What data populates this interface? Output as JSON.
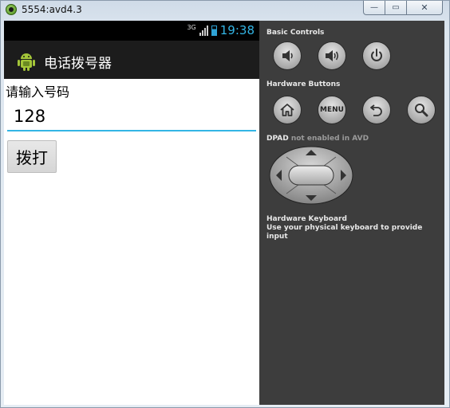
{
  "window": {
    "title": "5554:avd4.3",
    "controls": {
      "minimize": "—",
      "maximize": "▭",
      "close": "✕"
    }
  },
  "device": {
    "status_bar": {
      "network": "3G",
      "time": "19:38"
    },
    "action_bar": {
      "app_title": "电话拨号器",
      "icon": "android-icon"
    },
    "content": {
      "prompt_label": "请输入号码",
      "phone_input": {
        "value": "128",
        "placeholder": ""
      },
      "dial_button": "拨打"
    }
  },
  "controls_panel": {
    "basic_controls": {
      "title": "Basic Controls",
      "buttons": [
        {
          "name": "volume-down",
          "icon": "volume-down-icon"
        },
        {
          "name": "volume-up",
          "icon": "volume-up-icon"
        },
        {
          "name": "power",
          "icon": "power-icon"
        }
      ]
    },
    "hardware_buttons": {
      "title": "Hardware Buttons",
      "buttons": [
        {
          "name": "home",
          "icon": "home-icon"
        },
        {
          "name": "menu",
          "label": "MENU"
        },
        {
          "name": "back",
          "icon": "back-icon"
        },
        {
          "name": "search",
          "icon": "search-icon"
        }
      ]
    },
    "dpad": {
      "title": "DPAD",
      "note": "not enabled in AVD"
    },
    "keyboard": {
      "title": "Hardware Keyboard",
      "note": "Use your physical keyboard to provide input"
    }
  }
}
